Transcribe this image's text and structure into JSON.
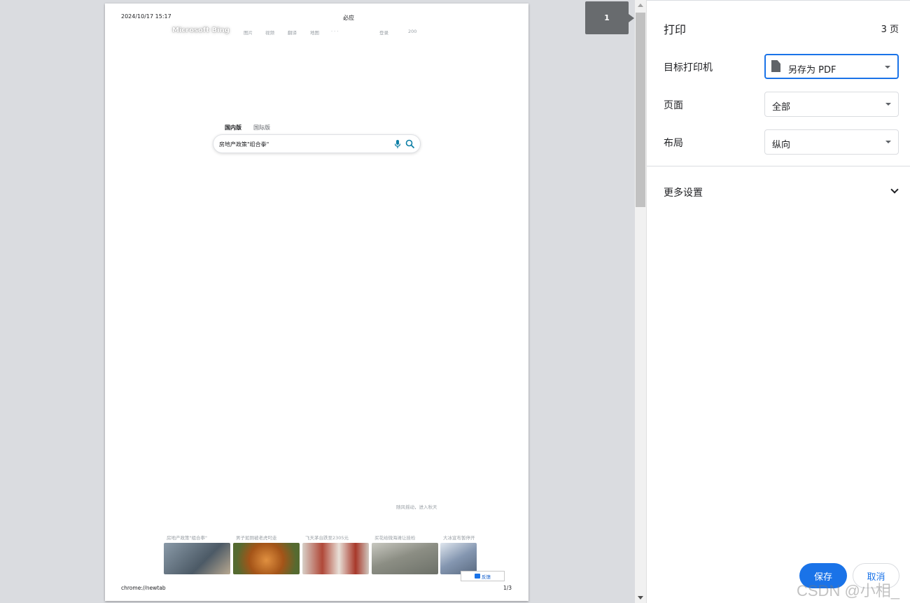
{
  "preview": {
    "header_date": "2024/10/17 15:17",
    "header_title": "必应",
    "footer_url": "chrome://newtab",
    "footer_page": "1/3",
    "page_badge": "1",
    "bing": {
      "logo": "Microsoft Bing",
      "nav": [
        "图片",
        "视频",
        "翻译",
        "地图",
        "· · ·",
        "登录",
        "200"
      ],
      "tabs": [
        "国内版",
        "国际版"
      ],
      "search_value": "房地产政策\"组合拳\"",
      "tagline": "随风摇动，进入秋天",
      "news": [
        {
          "caption": "房地产政策\"组合拳\"",
          "color": "#6b7a88"
        },
        {
          "caption": "男子如厕被老虎叼走",
          "color": "#b86a2a"
        },
        {
          "caption": "飞天茅台跌至2305元",
          "color": "#9a4a3a"
        },
        {
          "caption": "买花给微海滩让挂检",
          "color": "#8a8e88"
        },
        {
          "caption": "大冰宣布暂停开",
          "color": "#7a8aa0"
        }
      ],
      "feedback": "反馈"
    }
  },
  "sidebar": {
    "title": "打印",
    "pages_count": "3 页",
    "destination": {
      "label": "目标打印机",
      "value": "另存为 PDF",
      "icon": "pdf-file-icon"
    },
    "pages": {
      "label": "页面",
      "value": "全部"
    },
    "layout": {
      "label": "布局",
      "value": "纵向"
    },
    "more_settings": "更多设置",
    "save": "保存",
    "cancel": "取消",
    "watermark": "CSDN @小相_"
  },
  "colors": {
    "accent": "#1a73e8",
    "badge": "#686b6e",
    "preview_bg": "#dadce0"
  }
}
